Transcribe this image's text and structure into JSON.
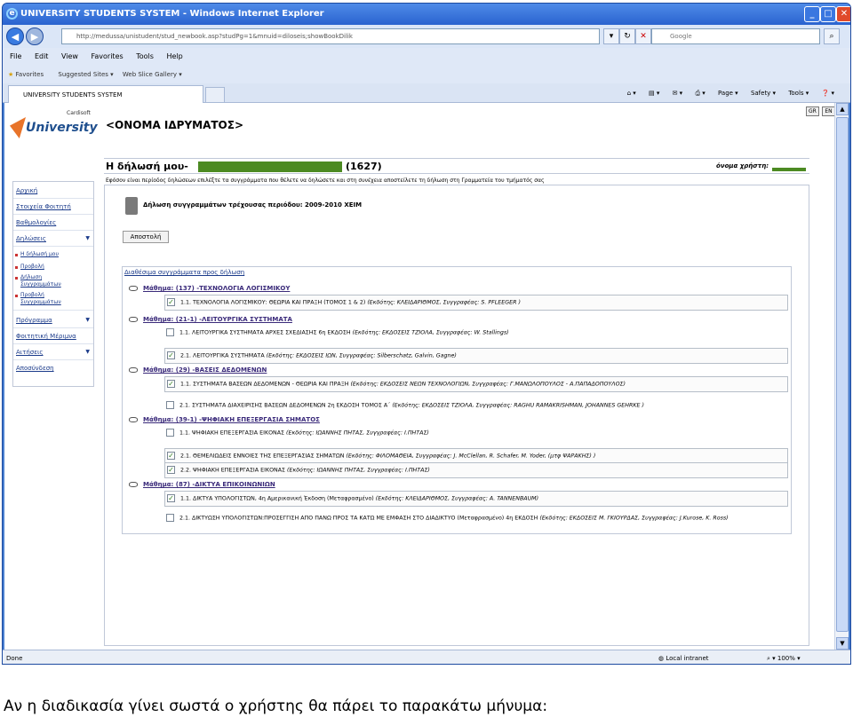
{
  "window": {
    "title": "UNIVERSITY STUDENTS SYSTEM - Windows Internet Explorer"
  },
  "browser": {
    "address": "http://medussa/unistudent/stud_newbook.asp?studPg=1&mnuid=diloseis;showBookDilik",
    "search_placeholder": "Google",
    "menu": [
      "File",
      "Edit",
      "View",
      "Favorites",
      "Tools",
      "Help"
    ],
    "favorites_bar": {
      "favorites": "Favorites",
      "suggested": "Suggested Sites ▾",
      "webslice": "Web Slice Gallery ▾"
    },
    "tab_title": "UNIVERSITY STUDENTS SYSTEM",
    "commands": [
      "Page ▾",
      "Safety ▾",
      "Tools ▾",
      "❓ ▾"
    ],
    "status_left": "Done",
    "status_zone": "Local intranet",
    "zoom": "100%"
  },
  "site": {
    "logo_text": "University",
    "logo_small": "Cardisoft",
    "institution": "<ΟΝΟΜΑ ΙΔΡΥΜΑΤΟΣ>",
    "lang_gr": "GR",
    "lang_en": "EN"
  },
  "sidebar": {
    "items": [
      "Αρχική",
      "Στοιχεία Φοιτητή",
      "Βαθμολογίες",
      "Δηλώσεις"
    ],
    "subitems": [
      "Η δήλωσή μου",
      "Προβολή",
      "Δήλωση Συγγραμμάτων",
      "Προβολή Συγγραμμάτων"
    ],
    "items2": [
      "Πρόγραμμα",
      "Φοιτητική Μέριμνα",
      "Αιτήσεις",
      "Αποσύνδεση"
    ]
  },
  "main": {
    "heading": "Η δήλωσή μου-",
    "count": "(1627)",
    "username_label": "όνομα χρήστη:",
    "info": "Εφόσον είναι περίοδος δηλώσεων επιλέξτε τα συγγράμματα που θέλετε να δηλώσετε και στη συνέχεια αποστείλετε τη δήλωση στη Γραμματεία του τμήματός σας",
    "decl_title": "Δήλωση συγγραμμάτων τρέχουσας περιόδου: 2009-2010 ΧΕΙΜ",
    "submit": "Αποστολή",
    "available": "Διαθέσιμα συγγράμματα προς δήλωση"
  },
  "courses": [
    {
      "label": "Μάθημα: (137) -ΤΕΧΝΟΛΟΓΙΑ ΛΟΓΙΣΜΙΚΟΥ",
      "books": [
        {
          "checked": true,
          "title": "1.1. ΤΕΧΝΟΛΟΓΙΑ ΛΟΓΙΣΜΙΚΟΥ: ΘΕΩΡΙΑ ΚΑΙ ΠΡΑΞΗ (ΤΟΜΟΣ 1 & 2)",
          "meta": "(Εκδότης: ΚΛΕΙΔΑΡΙΘΜΟΣ, Συγγραφέας: S. PFLEEGER )"
        }
      ]
    },
    {
      "label": "Μάθημα: (21-1) -ΛΕΙΤΟΥΡΓΙΚΑ ΣΥΣΤΗΜΑΤΑ",
      "books": [
        {
          "checked": false,
          "title": "1.1. ΛΕΙΤΟΥΡΓΙΚΑ ΣΥΣΤΗΜΑΤΑ ΑΡΧΕΣ ΣΧΕΔΙΑΣΗΣ 6η ΕΚΔΟΣΗ",
          "meta": "(Εκδότης: ΕΚΔΟΣΕΙΣ ΤΖΙΟΛΑ, Συγγραφέας: W. Stallings)"
        },
        {
          "checked": true,
          "title": "2.1. ΛΕΙΤΟΥΡΓΙΚΑ ΣΥΣΤΗΜΑΤΑ",
          "meta": "(Εκδότης: ΕΚΔΟΣΕΙΣ ΙΩΝ, Συγγραφέας: Silberschatz, Galvin, Gagne)"
        }
      ]
    },
    {
      "label": "Μάθημα: (29) -ΒΑΣΕΙΣ ΔΕΔΟΜΕΝΩΝ",
      "books": [
        {
          "checked": true,
          "title": "1.1. ΣΥΣΤΗΜΑΤΑ ΒΑΣΕΩΝ ΔΕΔΟΜΕΝΩΝ - ΘΕΩΡΙΑ ΚΑΙ ΠΡΑΞΗ",
          "meta": "(Εκδότης: ΕΚΔΟΣΕΙΣ ΝΕΩΝ ΤΕΧΝΟΛΟΓΙΩΝ, Συγγραφέας: Γ.ΜΑΝΩΛΟΠΟΥΛΟΣ - Α.ΠΑΠΑΔΟΠΟΥΛΟΣ)"
        },
        {
          "checked": false,
          "title": "2.1. ΣΥΣΤΗΜΑΤΑ ΔΙΑΧΕΙΡΙΣΗΣ ΒΑΣΕΩΝ ΔΕΔΟΜΕΝΩΝ 2η ΕΚΔΟΣΗ ΤΟΜΟΣ Α΄",
          "meta": "(Εκδότης: ΕΚΔΟΣΕΙΣ ΤΖΙΟΛΑ, Συγγραφέας: RAGHU RAMAKRISHMAN, JOHANNES GEHRKE )"
        }
      ]
    },
    {
      "label": "Μάθημα: (39-1) -ΨΗΦΙΑΚΗ ΕΠΕΞΕΡΓΑΣΙΑ ΣΗΜΑΤΟΣ",
      "books": [
        {
          "checked": false,
          "title": "1.1. ΨΗΦΙΑΚΗ ΕΠΕΞΕΡΓΑΣΙΑ ΕΙΚΟΝΑΣ",
          "meta": "(Εκδότης: ΙΩΑΝΝΗΣ ΠΗΤΑΣ, Συγγραφέας: Ι.ΠΗΤΑΣ)"
        },
        {
          "checked": true,
          "title": "2.1. ΘΕΜΕΛΙΩΔΕΙΣ ΕΝΝΟΙΕΣ ΤΗΣ ΕΠΕΞΕΡΓΑΣΙΑΣ ΣΗΜΑΤΩΝ",
          "meta": "(Εκδότης: ΦΙΛΟΜΑΘΕΙΑ, Συγγραφέας: J. McClellan, R. Schafer, M. Yoder, (μτφ ΨΑΡΑΚΗΣ) )"
        },
        {
          "checked": true,
          "title": "2.2. ΨΗΦΙΑΚΗ ΕΠΕΞΕΡΓΑΣΙΑ ΕΙΚΟΝΑΣ",
          "meta": "(Εκδότης: ΙΩΑΝΝΗΣ ΠΗΤΑΣ, Συγγραφέας: Ι.ΠΗΤΑΣ)"
        }
      ]
    },
    {
      "label": "Μάθημα: (87) -ΔΙΚΤΥΑ ΕΠΙΚΟΙΝΩΝΙΩΝ",
      "books": [
        {
          "checked": true,
          "title": "1.1. ΔΙΚΤΥΑ ΥΠΟΛΟΓΙΣΤΩΝ, 4η Αμερικανική Έκδοση (Μεταφρασμένο)",
          "meta": "(Εκδότης: ΚΛΕΙΔΑΡΙΘΜΟΣ, Συγγραφέας: A. TANNENBAUM)"
        },
        {
          "checked": false,
          "title": "2.1. ΔΙΚΤΥΩΣΗ ΥΠΟΛΟΓΙΣΤΩΝ:ΠΡΟΣΕΓΓΙΣΗ ΑΠΟ ΠΑΝΩ ΠΡΟΣ ΤΑ ΚΑΤΩ ΜΕ ΕΜΦΑΣΗ ΣΤΟ ΔΙΑΔΙΚΤΥΟ (Μεταφρασμένο) 4η ΕΚΔΟΣΗ",
          "meta": "(Εκδότης: ΕΚΔΟΣΕΙΣ Μ. ΓΚΙΟΥΡΔΑΣ, Συγγραφέας: J.Kurose, K. Ross)"
        }
      ]
    }
  ],
  "caption": "Αν η διαδικασία γίνει σωστά ο χρήστης θα πάρει το παρακάτω μήνυμα:"
}
